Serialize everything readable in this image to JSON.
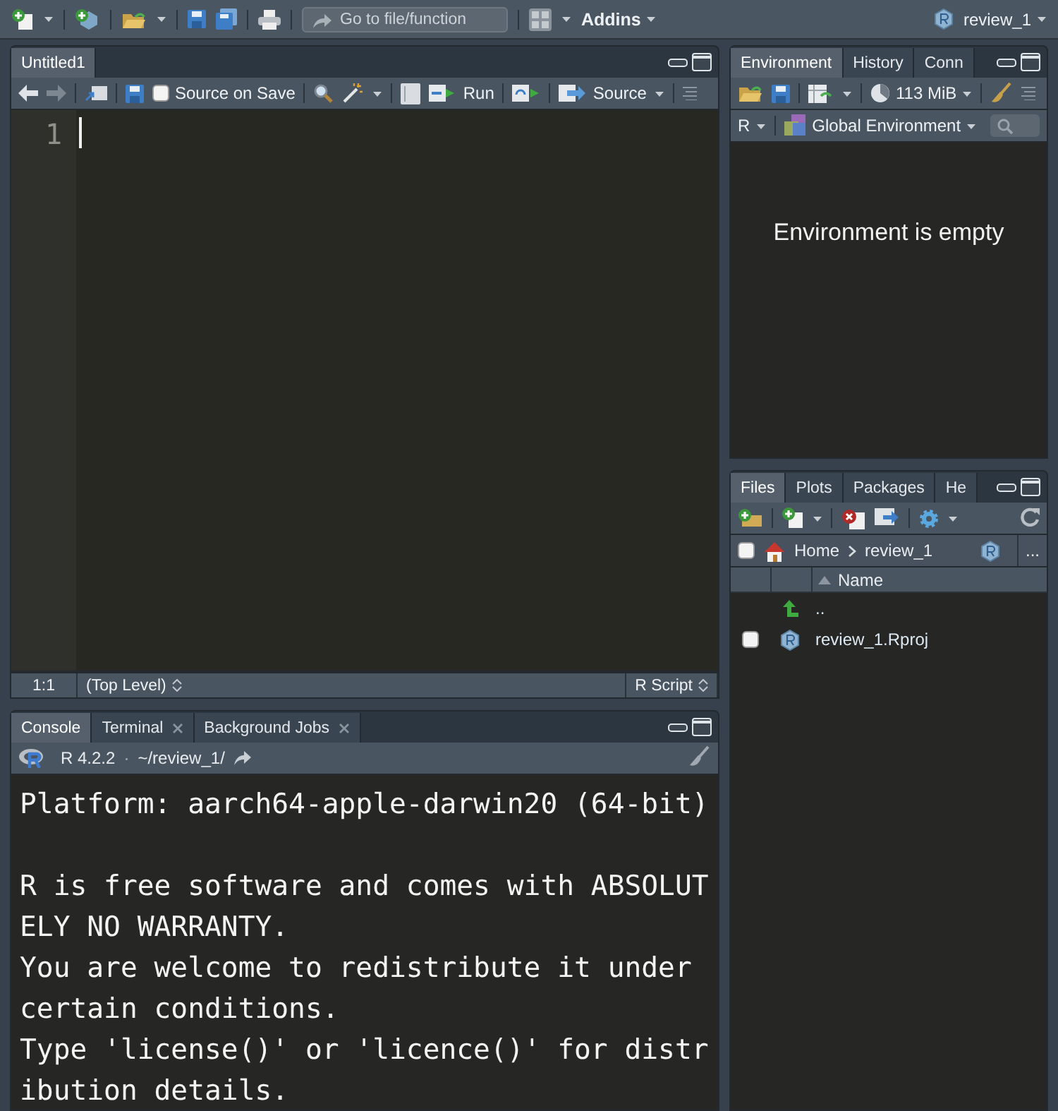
{
  "toolbar": {
    "goto_placeholder": "Go to file/function",
    "addins": "Addins",
    "project": "review_1"
  },
  "source": {
    "tabs": [
      {
        "label": "Untitled1",
        "selected": true
      }
    ],
    "source_on_save": {
      "label": "Source on Save",
      "checked": false
    },
    "run": "Run",
    "source_button": "Source",
    "line_numbers": [
      "1"
    ],
    "status": {
      "position": "1:1",
      "scope": "(Top Level)",
      "file_type": "R Script"
    }
  },
  "environment": {
    "tabs": [
      {
        "label": "Environment",
        "selected": true
      },
      {
        "label": "History",
        "selected": false
      },
      {
        "label": "Conn",
        "selected": false
      }
    ],
    "memory": "113 MiB",
    "language": "R",
    "scope": "Global Environment",
    "empty_message": "Environment is empty"
  },
  "files": {
    "tabs": [
      {
        "label": "Files",
        "selected": true
      },
      {
        "label": "Plots",
        "selected": false
      },
      {
        "label": "Packages",
        "selected": false
      },
      {
        "label": "He",
        "selected": false
      }
    ],
    "all_selected": false,
    "breadcrumb": [
      "Home",
      "review_1"
    ],
    "more": "...",
    "columns": [
      "Name"
    ],
    "rows": [
      {
        "kind": "parent",
        "name": ".."
      },
      {
        "kind": "file",
        "name": "review_1.Rproj",
        "checked": false
      }
    ]
  },
  "console": {
    "tabs": [
      {
        "label": "Console",
        "selected": true,
        "closable": false
      },
      {
        "label": "Terminal",
        "selected": false,
        "closable": true
      },
      {
        "label": "Background Jobs",
        "selected": false,
        "closable": true
      }
    ],
    "version": "R 4.2.2",
    "separator": "·",
    "path": "~/review_1/",
    "paragraphs": [
      [
        "Platform: aarch64-apple-darwin20 (64-bit)"
      ],
      [
        "R is free software and comes with ABSOLUT",
        "ELY NO WARRANTY.",
        "You are welcome to redistribute it under",
        "certain conditions.",
        "Type 'license()' or 'licence()' for distr",
        "ibution details."
      ]
    ]
  }
}
